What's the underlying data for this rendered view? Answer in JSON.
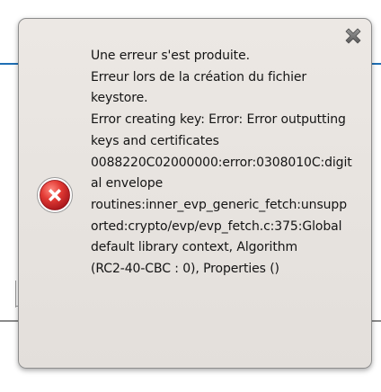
{
  "dialog": {
    "message_lines": [
      "Une erreur s'est produite.",
      "Erreur lors de la création du fichier",
      "keystore.",
      "Error creating key: Error: Error outputting",
      "keys and certificates",
      "0088220C02000000:error:0308010C:digit",
      "al envelope",
      "routines:inner_evp_generic_fetch:unsupp",
      "orted:crypto/evp/evp_fetch.c:375:Global",
      "default library context, Algorithm",
      "(RC2-40-CBC : 0), Properties ()"
    ],
    "icon": "error-icon",
    "close_icon": "close-icon"
  },
  "colors": {
    "error_red": "#c8202a",
    "dialog_bg": "#e8e4e0",
    "accent_blue": "#1f6fb4"
  }
}
